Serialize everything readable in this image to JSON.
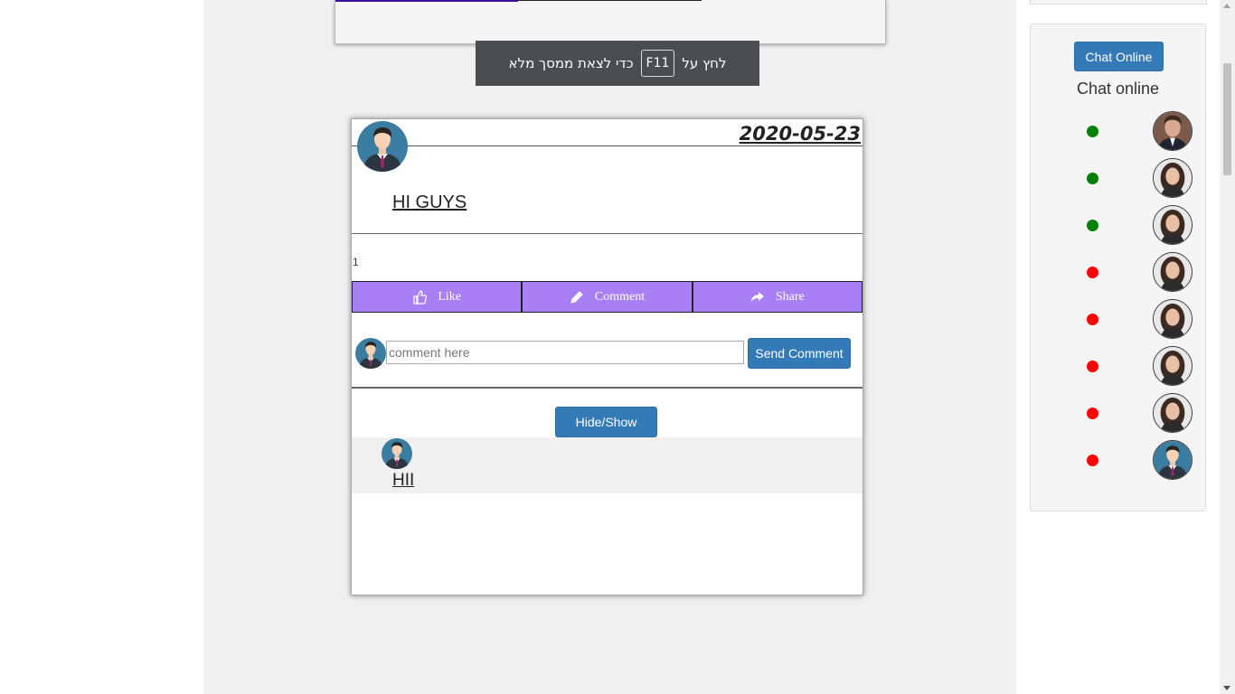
{
  "toast": {
    "before": "לחץ על",
    "key": "F11",
    "after": "כדי לצאת ממסך מלא"
  },
  "post": {
    "date": "2020-05-23",
    "text": "HI GUYS",
    "count": "1",
    "actions": {
      "like": "Like",
      "comment": "Comment",
      "share": "Share"
    },
    "comment_placeholder": "comment here",
    "send_label": "Send Comment",
    "toggle_label": "Hide/Show",
    "comments": [
      {
        "text": "HII"
      }
    ]
  },
  "sidebar": {
    "button_label": "Chat Online",
    "title": "Chat online",
    "status_colors": {
      "online": "#008000",
      "offline": "#ff0000"
    },
    "users": [
      {
        "status": "online",
        "avatar": "man-photo"
      },
      {
        "status": "online",
        "avatar": "woman-photo"
      },
      {
        "status": "online",
        "avatar": "woman-photo"
      },
      {
        "status": "offline",
        "avatar": "woman-photo"
      },
      {
        "status": "offline",
        "avatar": "woman-photo"
      },
      {
        "status": "offline",
        "avatar": "woman-photo"
      },
      {
        "status": "offline",
        "avatar": "woman-photo"
      },
      {
        "status": "offline",
        "avatar": "default-avatar"
      }
    ]
  },
  "colors": {
    "accent": "#337ab7",
    "action_bar": "#a87ff5"
  }
}
